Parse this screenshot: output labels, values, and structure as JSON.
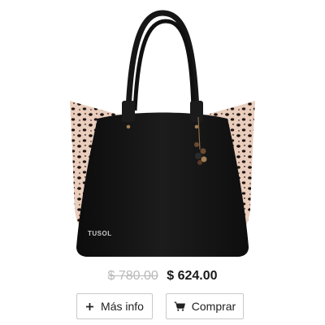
{
  "product": {
    "image_icon": "leopard-tote-handbag",
    "brand_label": "TUSOL",
    "colors": {
      "bag": "#141414",
      "leopard_base": "#e9cdbd",
      "leopard_spots": "#1e1410"
    }
  },
  "price": {
    "old": "$ 780.00",
    "new": "$ 624.00"
  },
  "actions": {
    "info_label": "Más info",
    "info_icon": "plus-icon",
    "buy_label": "Comprar",
    "buy_icon": "cart-icon"
  }
}
